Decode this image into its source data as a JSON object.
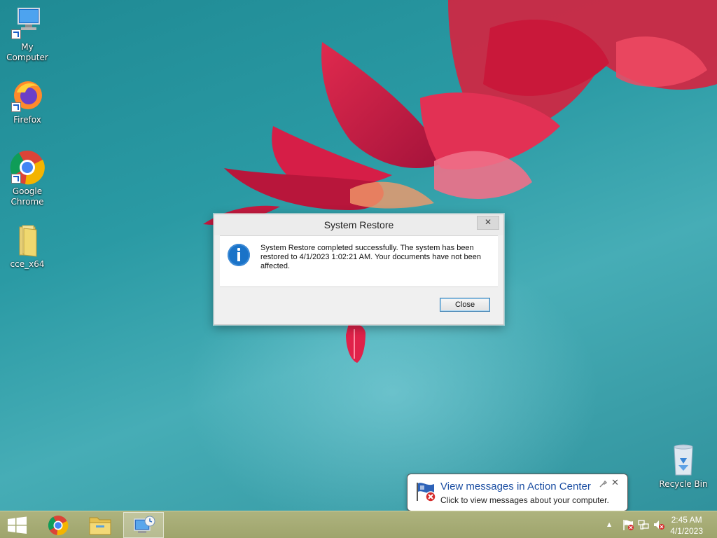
{
  "desktop": {
    "icons": [
      {
        "label": "My Computer",
        "icon": "computer-icon"
      },
      {
        "label": "Firefox",
        "icon": "firefox-icon"
      },
      {
        "label": "Google Chrome",
        "icon": "chrome-icon"
      },
      {
        "label": "cce_x64",
        "icon": "folder-icon"
      },
      {
        "label": "Recycle Bin",
        "icon": "recycle-bin-icon"
      }
    ]
  },
  "dialog": {
    "title": "System Restore",
    "message": "System Restore completed successfully. The system has been restored to 4/1/2023 1:02:21 AM. Your documents have not been affected.",
    "close_button": "Close",
    "icon": "info-icon",
    "title_close_glyph": "✕"
  },
  "balloon": {
    "title": "View messages in Action Center",
    "text": "Click to view messages about your computer.",
    "icon": "action-center-flag-icon",
    "close_glyph": "✕",
    "options_glyph": "🔧"
  },
  "taskbar": {
    "items": [
      {
        "name": "start",
        "icon": "windows-logo-icon"
      },
      {
        "name": "chrome",
        "icon": "chrome-icon"
      },
      {
        "name": "file-explorer",
        "icon": "file-explorer-icon"
      },
      {
        "name": "system-restore",
        "icon": "system-restore-icon"
      }
    ],
    "tray": {
      "overflow_glyph": "▲",
      "clock": {
        "time": "2:45 AM",
        "date": "4/1/2023"
      }
    }
  },
  "colors": {
    "taskbar": "#a4a96f",
    "desktop": "#2a9aa4",
    "accent": "#1a73c8",
    "balloon_title": "#1c4fa3"
  }
}
